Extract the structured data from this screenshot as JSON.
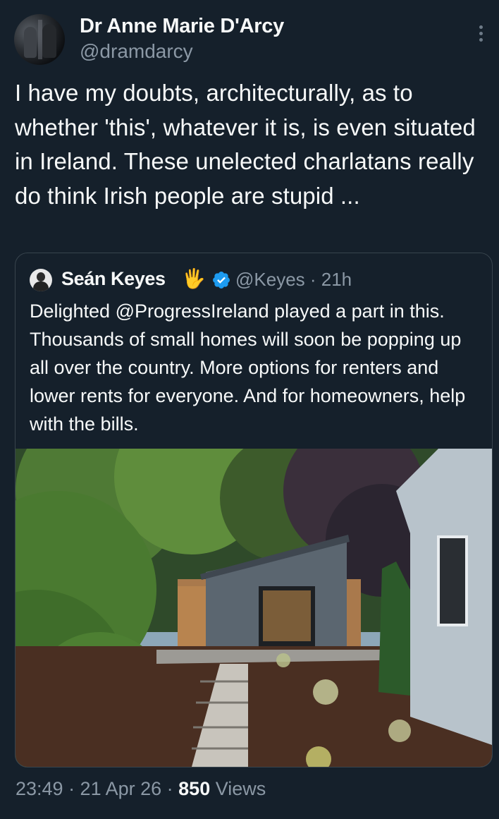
{
  "author": {
    "name": "Dr Anne Marie D'Arcy",
    "handle": "@dramdarcy"
  },
  "tweet": {
    "text": "I have my doubts, architecturally, as to whether 'this', whatever it is, is even situated in Ireland. These unelected charlatans really do think Irish people are stupid ..."
  },
  "quoted": {
    "name": "Seán Keyes",
    "emoji": "🖐",
    "handle_time": "@Keyes · 21h",
    "text": "Delighted @ProgressIreland played a part in this. Thousands of small homes will soon be popping up all over the country. More options for renters and lower rents for everyone. And for homeowners, help with the bills.",
    "verified_color": "#1d9bf0"
  },
  "footer": {
    "time_date": "23:49 · 21 Apr 26 · ",
    "views_count": "850",
    "views_label": " Views"
  },
  "icons": {
    "more": "more-vertical-icon",
    "verified": "verified-badge-icon"
  },
  "colors": {
    "background": "#15202b",
    "text": "#f7f9f9",
    "secondary": "#8b98a5",
    "border": "#38444d"
  }
}
